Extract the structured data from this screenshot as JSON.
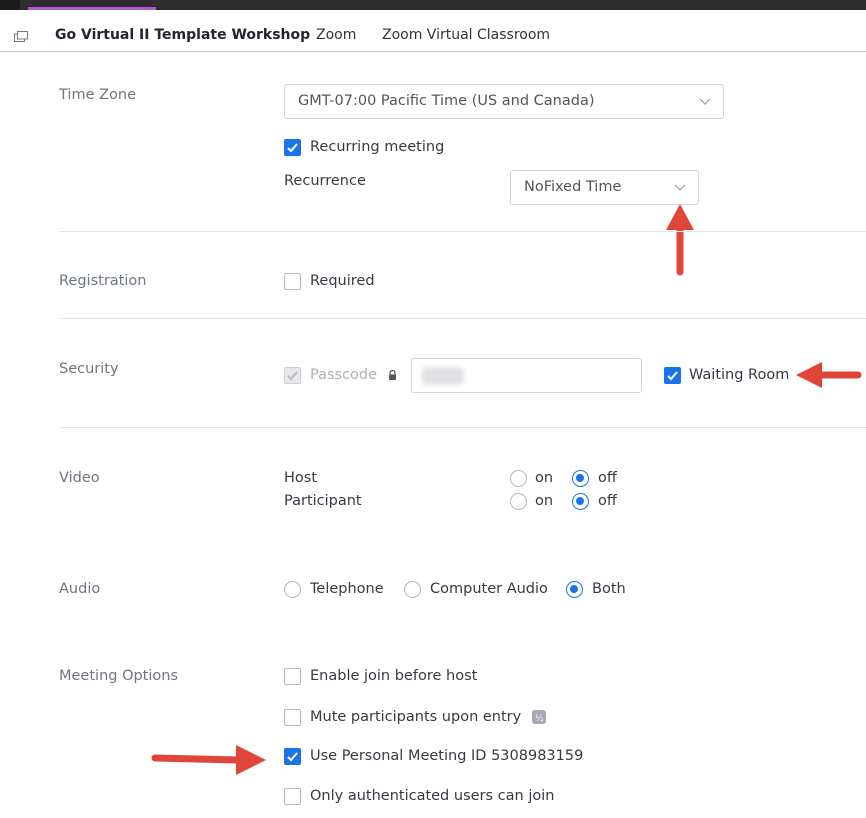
{
  "tabs": [
    {
      "label": "Go Virtual II Template Workshop"
    },
    {
      "label": "Zoom"
    },
    {
      "label": "Zoom Virtual Classroom"
    }
  ],
  "timezone": {
    "label": "Time Zone",
    "value": "GMT-07:00 Pacific Time (US and Canada)"
  },
  "recurring": {
    "checkbox_label": "Recurring meeting",
    "checked": true,
    "recurrence_label": "Recurrence",
    "recurrence_value": "NoFixed Time"
  },
  "registration": {
    "label": "Registration",
    "required_label": "Required",
    "checked": false
  },
  "security": {
    "label": "Security",
    "passcode_label": "Passcode",
    "passcode_checked": true,
    "waiting_room_label": "Waiting Room",
    "waiting_room_checked": true
  },
  "video": {
    "label": "Video",
    "host_label": "Host",
    "participant_label": "Participant",
    "on_label": "on",
    "off_label": "off",
    "host_value": "off",
    "participant_value": "off"
  },
  "audio": {
    "label": "Audio",
    "options": [
      "Telephone",
      "Computer Audio",
      "Both"
    ],
    "selected": "Both"
  },
  "meeting_options": {
    "label": "Meeting Options",
    "items": [
      {
        "label": "Enable join before host",
        "checked": false
      },
      {
        "label": "Mute participants upon entry",
        "checked": false
      },
      {
        "label": "Use Personal Meeting ID 5308983159",
        "checked": true
      },
      {
        "label": "Only authenticated users can join",
        "checked": false
      }
    ]
  },
  "colors": {
    "accent": "#1a73e8",
    "tab_indicator": "#b65ad3",
    "annotation_arrow": "#e0453a"
  }
}
